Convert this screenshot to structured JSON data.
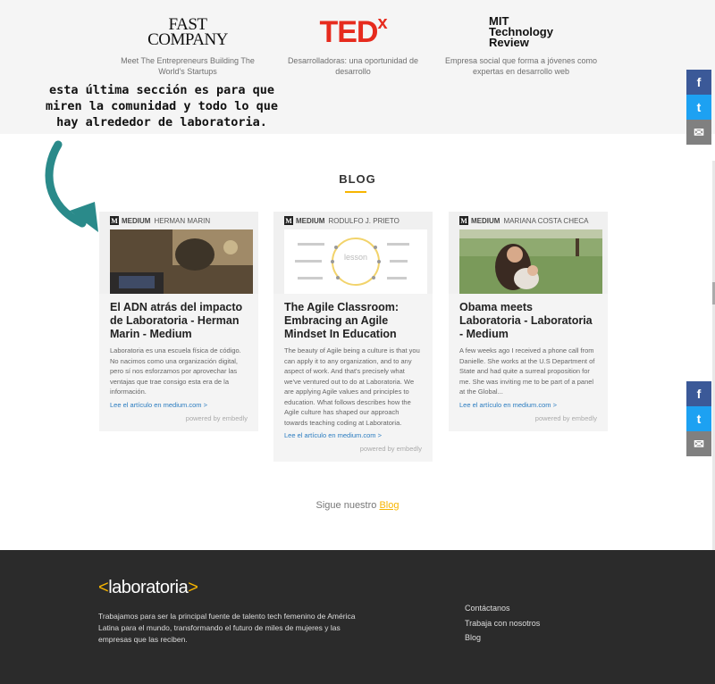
{
  "press": [
    {
      "name": "fast-company-logo",
      "logo_line1": "FAST",
      "logo_line2": "COMPANY",
      "caption": "Meet The Entrepreneurs Building The World's Startups"
    },
    {
      "name": "tedx-logo",
      "logo": "TED",
      "logo_sup": "x",
      "caption": "Desarrolladoras: una oportunidad de desarrollo"
    },
    {
      "name": "mit-logo",
      "logo_line1": "MIT",
      "logo_line2": "Technology",
      "logo_line3": "Review",
      "caption": "Empresa social que forma a jóvenes como expertas en desarrollo web"
    }
  ],
  "annotation": "esta última sección es para que miren la comunidad y todo lo que hay alrededor de laboratoria.",
  "blog": {
    "title": "BLOG",
    "source": "MEDIUM",
    "cards": [
      {
        "author": "HERMAN MARIN",
        "title": "El ADN atrás del impacto de Laboratoria - Herman Marin - Medium",
        "desc": "Laboratoria es una escuela física de código. No nacimos como una organización digital, pero sí nos esforzamos por aprovechar las ventajas que trae consigo esta era de la información.",
        "link": "Lee el artículo en medium.com >",
        "powered": "powered by embedly"
      },
      {
        "author": "RODULFO J. PRIETO",
        "title": "The Agile Classroom: Embracing an Agile Mindset In Education",
        "desc": "The beauty of Agile being a culture is that you can apply it to any organization, and to any aspect of work. And that's precisely what we've ventured out to do at Laboratoria. We are applying Agile values and principles to education. What follows describes how the Agile culture has shaped our approach towards teaching coding at Laboratoria.",
        "link": "Lee el artículo en medium.com >",
        "powered": "powered by embedly",
        "image_text": "lesson"
      },
      {
        "author": "MARIANA COSTA CHECA",
        "title": "Obama meets Laboratoria - Laboratoria - Medium",
        "desc": "A few weeks ago I received a phone call from Danielle. She works at the U.S Department of State and had quite a surreal proposition for me. She was inviting me to be part of a panel at the Global...",
        "link": "Lee el artículo en medium.com >",
        "powered": "powered by embedly"
      }
    ],
    "follow_text": "Sigue nuestro ",
    "follow_link": "Blog"
  },
  "social": {
    "facebook": "f",
    "twitter": "t",
    "email": "✉"
  },
  "footer": {
    "logo_left": "<",
    "logo_name": "laboratoria",
    "logo_right": ">",
    "text": "Trabajamos para ser la principal fuente de talento tech femenino de América Latina para el mundo, transformando el futuro de miles de mujeres y las empresas que las reciben.",
    "links": [
      "Contáctanos",
      "Trabaja con nosotros",
      "Blog"
    ]
  },
  "colors": {
    "accent": "#f7b500",
    "ted": "#e62b1e",
    "link": "#2a7cc0",
    "facebook": "#3b5998",
    "twitter": "#1da1f2",
    "footer_bg": "#2b2b2b"
  }
}
